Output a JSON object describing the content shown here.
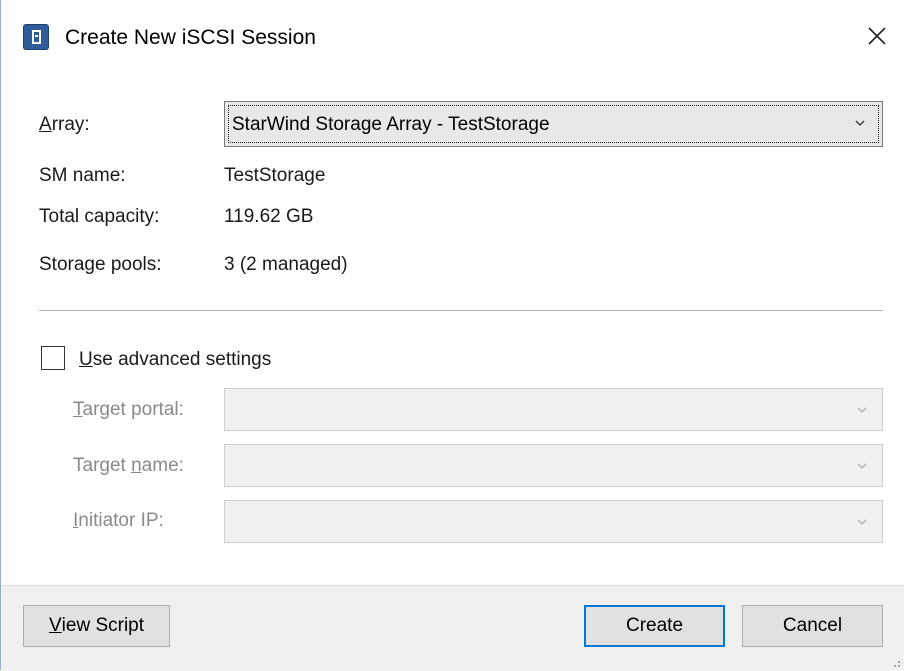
{
  "window": {
    "title": "Create New iSCSI Session"
  },
  "icons": {
    "app": "storage-array-icon",
    "close": "close-icon",
    "dropdown": "chevron-down-icon"
  },
  "colors": {
    "accent": "#0078d7",
    "app_icon": "#2e5d99",
    "disabled_text": "#8a8a8a",
    "footer_bg": "#f0f0f0"
  },
  "info": {
    "array": {
      "label_accel": "A",
      "label_rest": "rray:",
      "selected": "StarWind Storage Array - TestStorage"
    },
    "sm_name": {
      "label": "SM name:",
      "value": "TestStorage"
    },
    "total_capacity": {
      "label": "Total capacity:",
      "value": "119.62 GB"
    },
    "storage_pools": {
      "label": "Storage pools:",
      "value": "3 (2 managed)"
    }
  },
  "advanced": {
    "checkbox": {
      "accel": "U",
      "rest": "se advanced settings",
      "checked": false
    },
    "target_portal": {
      "pre": "",
      "accel": "T",
      "post": "arget portal:",
      "value": ""
    },
    "target_name": {
      "pre": "Target ",
      "accel": "n",
      "post": "ame:",
      "value": ""
    },
    "initiator_ip": {
      "pre": "",
      "accel": "I",
      "post": "nitiator IP:",
      "value": ""
    }
  },
  "footer": {
    "view_script": {
      "accel": "V",
      "rest": "iew Script"
    },
    "create": "Create",
    "cancel": "Cancel"
  }
}
